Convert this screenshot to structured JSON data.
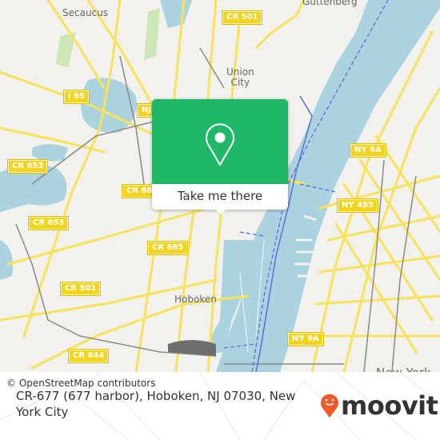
{
  "map": {
    "places": {
      "secaucus": "Secaucus",
      "guttenberg": "Guttenberg",
      "union_city": "Union\nCity",
      "hoboken": "Hoboken",
      "new_york": "New York"
    },
    "shields": {
      "cr501_top": "CR 501",
      "i95": "I 95",
      "nj": "NJ",
      "cr653_a": "CR 653",
      "cr68": "CR 68",
      "cr653_b": "CR 653",
      "cr685": "CR 685",
      "cr501_left": "CR 501",
      "cr644": "CR 644",
      "ny9a_top": "NY 9A",
      "ny495": "NY 495",
      "ny9a_bottom": "NY 9A"
    },
    "colors": {
      "water": "#aad3df",
      "land": "#f2f1ed",
      "road": "#f7e35a",
      "ferry": "#5b6ee1"
    }
  },
  "popup": {
    "button_label": "Take me there",
    "icon": "location-pin-icon",
    "color": "#1fb866"
  },
  "attribution": "© OpenStreetMap contributors",
  "footer": {
    "address": "CR-677 (677 harbor), Hoboken, NJ 07030, New York City",
    "brand": "moovit",
    "brand_icon": "moovit-pin-icon",
    "brand_color": "#f05a28"
  }
}
